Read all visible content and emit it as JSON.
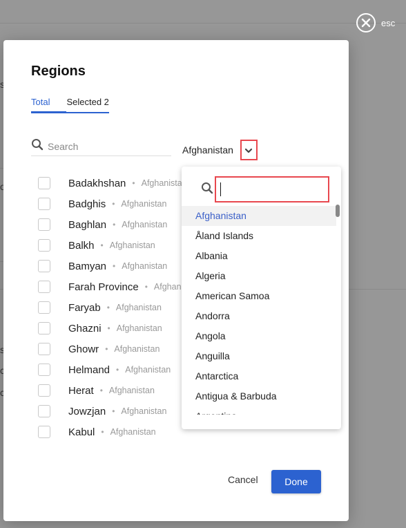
{
  "overlay": {
    "close_label": "esc",
    "background_fragments": [
      "s",
      "o",
      "s",
      "c",
      "c"
    ]
  },
  "modal": {
    "title": "Regions",
    "tabs": [
      {
        "label": "Total",
        "active": true
      },
      {
        "label": "Selected 2",
        "active": false
      }
    ],
    "search": {
      "placeholder": "Search",
      "value": ""
    },
    "country_filter": {
      "selected": "Afghanistan"
    },
    "regions": [
      {
        "name": "Badakhshan",
        "country": "Afghanistan",
        "checked": false
      },
      {
        "name": "Badghis",
        "country": "Afghanistan",
        "checked": false
      },
      {
        "name": "Baghlan",
        "country": "Afghanistan",
        "checked": false
      },
      {
        "name": "Balkh",
        "country": "Afghanistan",
        "checked": false
      },
      {
        "name": "Bamyan",
        "country": "Afghanistan",
        "checked": false
      },
      {
        "name": "Farah Province",
        "country": "Afghanistan",
        "checked": false
      },
      {
        "name": "Faryab",
        "country": "Afghanistan",
        "checked": false
      },
      {
        "name": "Ghazni",
        "country": "Afghanistan",
        "checked": false
      },
      {
        "name": "Ghowr",
        "country": "Afghanistan",
        "checked": false
      },
      {
        "name": "Helmand",
        "country": "Afghanistan",
        "checked": false
      },
      {
        "name": "Herat",
        "country": "Afghanistan",
        "checked": false
      },
      {
        "name": "Jowzjan",
        "country": "Afghanistan",
        "checked": false
      },
      {
        "name": "Kabul",
        "country": "Afghanistan",
        "checked": false
      }
    ],
    "separator": "•",
    "cancel_label": "Cancel",
    "done_label": "Done"
  },
  "country_dropdown": {
    "search_value": "",
    "options": [
      {
        "label": "Afghanistan",
        "selected": true
      },
      {
        "label": "Åland Islands",
        "selected": false
      },
      {
        "label": "Albania",
        "selected": false
      },
      {
        "label": "Algeria",
        "selected": false
      },
      {
        "label": "American Samoa",
        "selected": false
      },
      {
        "label": "Andorra",
        "selected": false
      },
      {
        "label": "Angola",
        "selected": false
      },
      {
        "label": "Anguilla",
        "selected": false
      },
      {
        "label": "Antarctica",
        "selected": false
      },
      {
        "label": "Antigua & Barbuda",
        "selected": false
      },
      {
        "label": "Argentina",
        "selected": false
      }
    ]
  },
  "colors": {
    "accent": "#2c62d0",
    "highlight_border": "#e8474e",
    "overlay": "#979797"
  }
}
